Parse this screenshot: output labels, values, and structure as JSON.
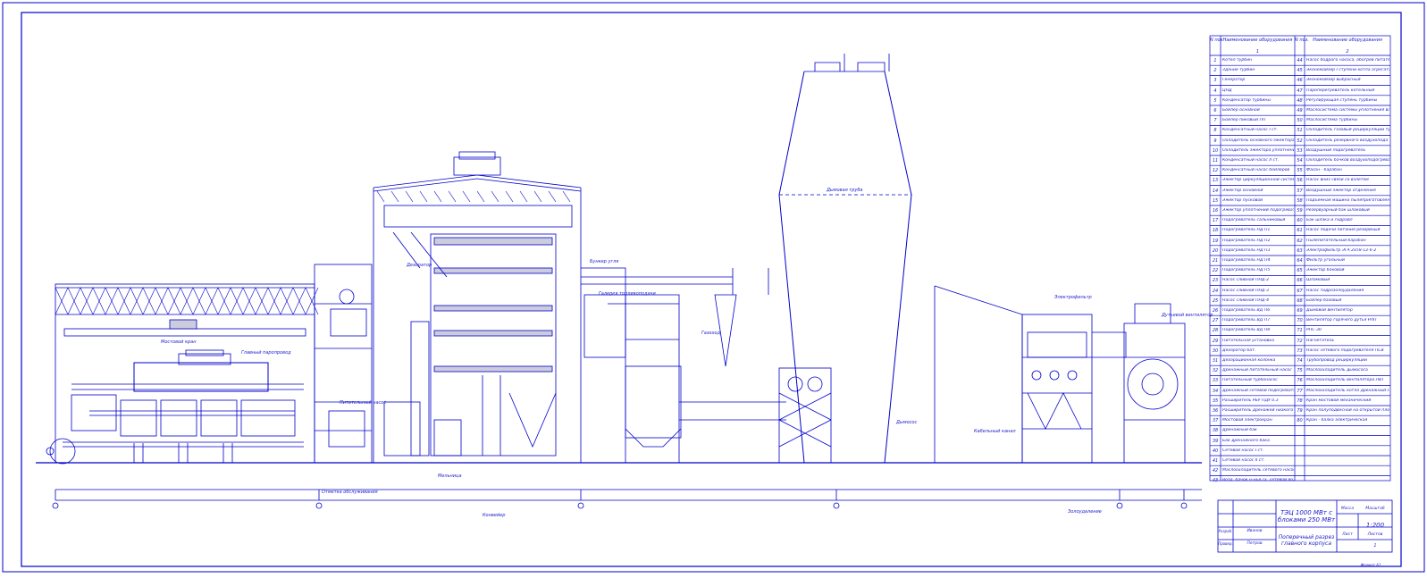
{
  "drawing": {
    "scale": "1:200",
    "colors": {
      "line": "#0000cc",
      "accent": "#00008b",
      "paper": "#ffffff"
    },
    "section_annotations": {
      "turbine_hall_crane": "Мостовой кран",
      "pipe_note": "Главный паропровод",
      "deaerator_label": "Деаэратор",
      "bunker_label": "Бункер угля",
      "gallery_label": "Галерея топливоподачи",
      "stack_label": "Дымовая труба",
      "precipitator_label": "Электрофильтр",
      "smoke_label": "Дымосос",
      "fan_label": "Дутьевой вентилятор",
      "mill_label": "Мельница",
      "floor_label": "Отметка обслуживания",
      "pump_label": "Питательный насос",
      "flue_label": "Газоход",
      "ash_label": "Золоудаление",
      "cable_label": "Кабельный канал",
      "conveyor_label": "Конвейер"
    }
  },
  "legend": {
    "col_no": "N поз.",
    "col_name": "Наименование оборудования",
    "col_idx1": "1",
    "col_idx2": "2",
    "left": [
      {
        "no": "1",
        "name": "Котел турбин"
      },
      {
        "no": "2",
        "name": "Здание турбин"
      },
      {
        "no": "3",
        "name": "Генератор"
      },
      {
        "no": "4",
        "name": "ЦНД"
      },
      {
        "no": "5",
        "name": "Конденсатор турбины"
      },
      {
        "no": "6",
        "name": "Бойлер основной"
      },
      {
        "no": "7",
        "name": "Бойлер пиковый ПП"
      },
      {
        "no": "8",
        "name": "Конденсатный насос I ст."
      },
      {
        "no": "9",
        "name": "Охладитель основного эжектора"
      },
      {
        "no": "10",
        "name": "Охладитель эжектора уплотнений"
      },
      {
        "no": "11",
        "name": "Конденсатный насос II ст."
      },
      {
        "no": "12",
        "name": "Конденсатный насос бойлеров"
      },
      {
        "no": "13",
        "name": "Эжектор циркуляционной системы"
      },
      {
        "no": "14",
        "name": "Эжектор основной"
      },
      {
        "no": "15",
        "name": "Эжектор пусковой"
      },
      {
        "no": "16",
        "name": "Эжектор уплотнений подогревателя"
      },
      {
        "no": "17",
        "name": "Подогреватель сальниковый"
      },
      {
        "no": "18",
        "name": "Подогреватель НД П1"
      },
      {
        "no": "19",
        "name": "Подогреватель НД П2"
      },
      {
        "no": "20",
        "name": "Подогреватель НД П3"
      },
      {
        "no": "21",
        "name": "Подогреватель НД П4"
      },
      {
        "no": "22",
        "name": "Подогреватель НД П5"
      },
      {
        "no": "23",
        "name": "Насос сливной ПНД-2"
      },
      {
        "no": "24",
        "name": "Насос сливной ПНД-3"
      },
      {
        "no": "25",
        "name": "Насос сливной ПНД-4"
      },
      {
        "no": "26",
        "name": "Подогреватель ВД П6"
      },
      {
        "no": "27",
        "name": "Подогреватель ВД П7"
      },
      {
        "no": "28",
        "name": "Подогреватель ВД П8"
      },
      {
        "no": "29",
        "name": "Питательная установка"
      },
      {
        "no": "30",
        "name": "Деаэратор 6ат."
      },
      {
        "no": "31",
        "name": "Деаэрационная колонка"
      },
      {
        "no": "32",
        "name": "Дренажный питательный насос"
      },
      {
        "no": "33",
        "name": "Питательный турбонасос"
      },
      {
        "no": "34",
        "name": "Дренажный сетевой подогреватель"
      },
      {
        "no": "35",
        "name": "Расширитель РБУ ПДУ 0.3"
      },
      {
        "no": "36",
        "name": "Расширитель дренажей низкого давления"
      },
      {
        "no": "37",
        "name": "Мостовой электрокран"
      },
      {
        "no": "38",
        "name": "Дренажный бак"
      },
      {
        "no": "39",
        "name": "Бак дренажного бака"
      },
      {
        "no": "40",
        "name": "Сетевой насос I ст."
      },
      {
        "no": "41",
        "name": "Сетевой насос II ст."
      },
      {
        "no": "42",
        "name": "Маслоохладитель сетевого насоса II ст."
      },
      {
        "no": "43",
        "name": "Возд. бачок н-нья сх. сетевой воды"
      }
    ],
    "right": [
      {
        "no": "44",
        "name": "Насос бодрого насоса, обогрев питательного насоса"
      },
      {
        "no": "45",
        "name": "Экономайзер I ступени котла агрегата"
      },
      {
        "no": "46",
        "name": "Экономайзер выбросный"
      },
      {
        "no": "47",
        "name": "Пароперегреватель котельный"
      },
      {
        "no": "48",
        "name": "Регулирующая ступень турбины"
      },
      {
        "no": "49",
        "name": "Маслосистема системы уплотнения вала генератора"
      },
      {
        "no": "50",
        "name": "Маслосистема турбины"
      },
      {
        "no": "51",
        "name": "Охладитель газовый рециркуляции турбины"
      },
      {
        "no": "52",
        "name": "Охладитель резервного воздухопода"
      },
      {
        "no": "53",
        "name": "Воздушный подогреватель"
      },
      {
        "no": "54",
        "name": "Охладитель бачков воздухоподогревателя"
      },
      {
        "no": "55",
        "name": "Фасон - барабан"
      },
      {
        "no": "56",
        "name": "Насос вниз связи со взлетом"
      },
      {
        "no": "57",
        "name": "Воздушный эжектор отделения"
      },
      {
        "no": "58",
        "name": "Подъемная машина пылеприготовления"
      },
      {
        "no": "59",
        "name": "Резервуарный бак шлаковый"
      },
      {
        "no": "60",
        "name": "Бак шлака и гидравл"
      },
      {
        "no": "61",
        "name": "Насос подачи питания резервный"
      },
      {
        "no": "62",
        "name": "Пылепитательный барабан"
      },
      {
        "no": "63",
        "name": "Электрофильтр ЭГА 2х58-12-6-2"
      },
      {
        "no": "64",
        "name": "Фильтр угольный"
      },
      {
        "no": "65",
        "name": "Эжектор боковой"
      },
      {
        "no": "66",
        "name": "Шламовый"
      },
      {
        "no": "67",
        "name": "Насос гидрозолоудаления"
      },
      {
        "no": "68",
        "name": "Бойлер базовый"
      },
      {
        "no": "69",
        "name": "Дымовой вентилятор"
      },
      {
        "no": "70",
        "name": "Вентилятор горячего дутья РЛП"
      },
      {
        "no": "71",
        "name": "РПС-30"
      },
      {
        "no": "72",
        "name": "Нагнетатель"
      },
      {
        "no": "73",
        "name": "Насос сетевого подогревателя ПСВ"
      },
      {
        "no": "74",
        "name": "Трубопровод рециркуляции"
      },
      {
        "no": "75",
        "name": "Маслоохладитель дымососа"
      },
      {
        "no": "76",
        "name": "Маслоохладитель вентилятора ЛВТ"
      },
      {
        "no": "77",
        "name": "Маслоохладитель котла дренажный ЛВТ"
      },
      {
        "no": "78",
        "name": "Кран мостовой механический"
      },
      {
        "no": "79",
        "name": "Кран полуподвесной на открытой площадке"
      },
      {
        "no": "80",
        "name": "Кран - балка электрическая"
      }
    ]
  },
  "title_block": {
    "project": "ТЭЦ 1000 МВт с блоками 250 МВт",
    "sheet_title": "Поперечный разрез главного корпуса",
    "stage_label": "Лист",
    "mass_label": "Масса",
    "scale_label": "Масштаб",
    "scale_value": "1:200",
    "sheet_label": "Листов",
    "sheet_value": "1",
    "role_1": "Разраб.",
    "role_2": "Провер.",
    "name_1": "Иванов",
    "name_2": "Петров",
    "footer": "Формат А1"
  }
}
